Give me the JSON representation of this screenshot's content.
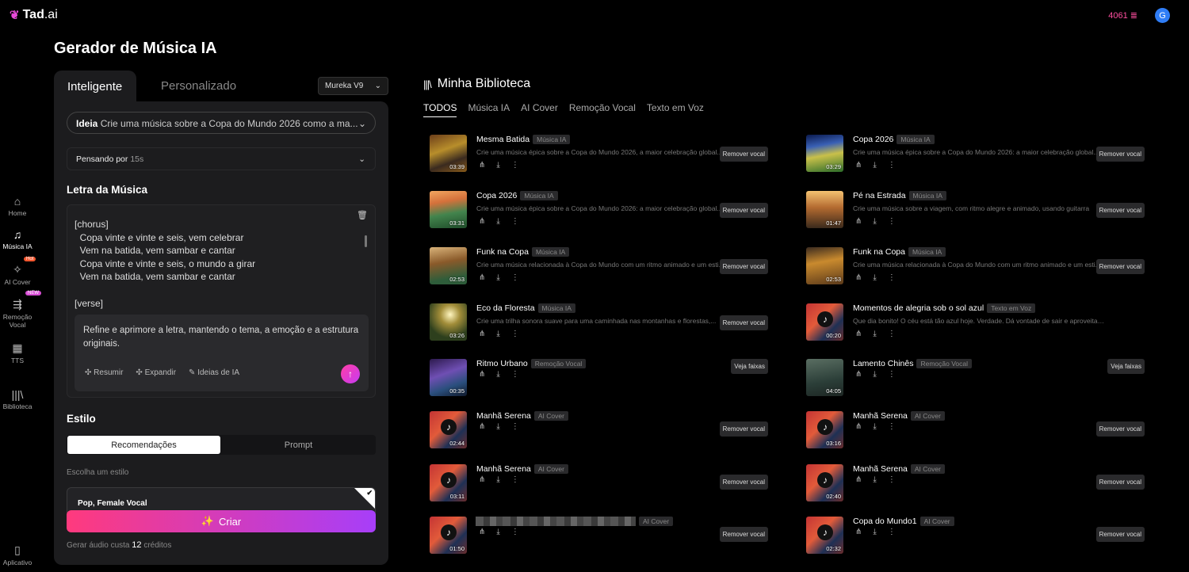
{
  "app": {
    "logo": "Tad",
    "logo_suffix": ".ai",
    "credits": "4061",
    "avatar_initial": "G"
  },
  "sidebar": [
    {
      "label": "Home",
      "icon": "home-icon"
    },
    {
      "label": "Música IA",
      "icon": "music-icon",
      "active": true
    },
    {
      "label": "AI Cover",
      "icon": "cover-icon",
      "badge": "Hot"
    },
    {
      "label": "Remoção Vocal",
      "icon": "vocal-remove-icon",
      "badge": "NEW"
    },
    {
      "label": "TTS",
      "icon": "tts-icon"
    },
    {
      "label": "Biblioteca",
      "icon": "library-icon"
    },
    {
      "label": "Aplicativo",
      "icon": "mobile-icon"
    }
  ],
  "page_title": "Gerador de Música IA",
  "mode_tabs": {
    "active": "Inteligente",
    "inactive": "Personalizado"
  },
  "model": "Mureka V9",
  "idea": {
    "label": "Ideia",
    "text": "Crie uma música sobre a Copa do Mundo 2026 como a ma..."
  },
  "thinking": {
    "label": "Pensando por",
    "time": "15s"
  },
  "lyrics_title": "Letra da Música",
  "lyrics_text": "[chorus]\n  Copa vinte e vinte e seis, vem celebrar\n  Vem na batida, vem sambar e cantar\n  Copa vinte e vinte e seis, o mundo a girar\n  Vem na batida, vem sambar e cantar\n\n[verse]",
  "refine": {
    "text": "Refine e aprimore a letra, mantendo o tema, a emoção e a estrutura originais.",
    "actions": [
      "Resumir",
      "Expandir",
      "Ideias de IA"
    ]
  },
  "style": {
    "title": "Estilo",
    "tabs": [
      "Recomendações",
      "Prompt"
    ],
    "choose_label": "Escolha um estilo",
    "selected": "Pop, Female Vocal"
  },
  "create_label": "Criar",
  "cost": {
    "prefix": "Gerar áudio custa",
    "amount": "12",
    "suffix": "créditos"
  },
  "library": {
    "title": "Minha Biblioteca",
    "filters": [
      "TODOS",
      "Música IA",
      "AI Cover",
      "Remoção Vocal",
      "Texto em Voz"
    ]
  },
  "songs": [
    {
      "name": "Mesma Batida",
      "tag": "Música IA",
      "desc": "Crie uma música épica sobre a Copa do Mundo 2026, a maior celebração global...",
      "dur": "03:39",
      "btn": "Remover vocal",
      "thumb": "t1"
    },
    {
      "name": "Copa 2026",
      "tag": "Música IA",
      "desc": "Crie uma música épica sobre a Copa do Mundo 2026: a maior celebração global...",
      "dur": "03:29",
      "btn": "Remover vocal",
      "thumb": "t2"
    },
    {
      "name": "Copa 2026",
      "tag": "Música IA",
      "desc": "Crie uma música épica sobre a Copa do Mundo 2026: a maior celebração global...",
      "dur": "03:31",
      "btn": "Remover vocal",
      "thumb": "t3"
    },
    {
      "name": "Pé na Estrada",
      "tag": "Música IA",
      "desc": "Crie uma música sobre a viagem, com ritmo alegre e animado, usando guitarra",
      "dur": "01:47",
      "btn": "Remover vocal",
      "thumb": "t4"
    },
    {
      "name": "Funk na Copa",
      "tag": "Música IA",
      "desc": "Crie uma música relacionada à Copa do Mundo com um ritmo animado e um esti...",
      "dur": "02:53",
      "btn": "Remover vocal",
      "thumb": "t5"
    },
    {
      "name": "Funk na Copa",
      "tag": "Música IA",
      "desc": "Crie uma música relacionada à Copa do Mundo com um ritmo animado e um esti...",
      "dur": "02:53",
      "btn": "Remover vocal",
      "thumb": "t6"
    },
    {
      "name": "Eco da Floresta",
      "tag": "Música IA",
      "desc": "Crie uma trilha sonora suave para uma caminhada nas montanhas e florestas,...",
      "dur": "03:26",
      "btn": "Remover vocal",
      "thumb": "t7"
    },
    {
      "name": "Momentos de alegria sob o sol azul",
      "tag": "Texto em Voz",
      "desc": "Que dia bonito! O céu está tão azul hoje. Verdade. Dá vontade de sair e aproveitar o sol. Às veze...",
      "dur": "00:20",
      "btn": "",
      "thumb": "tr",
      "note": true
    },
    {
      "name": "Ritmo Urbano",
      "tag": "Remoção Vocal",
      "desc": "",
      "dur": "00:35",
      "btn": "Veja faixas",
      "thumb": "t8"
    },
    {
      "name": "Lamento Chinês",
      "tag": "Remoção Vocal",
      "desc": "",
      "dur": "04:05",
      "btn": "Veja faixas",
      "thumb": "t9"
    },
    {
      "name": "Manhã Serena",
      "tag": "AI Cover",
      "desc": "",
      "dur": "02:44",
      "btn": "Remover vocal",
      "thumb": "tr",
      "note": true
    },
    {
      "name": "Manhã Serena",
      "tag": "AI Cover",
      "desc": "",
      "dur": "03:16",
      "btn": "Remover vocal",
      "thumb": "tr",
      "note": true
    },
    {
      "name": "Manhã Serena",
      "tag": "AI Cover",
      "desc": "",
      "dur": "03:11",
      "btn": "Remover vocal",
      "thumb": "tr",
      "note": true
    },
    {
      "name": "Manhã Serena",
      "tag": "AI Cover",
      "desc": "",
      "dur": "02:40",
      "btn": "Remover vocal",
      "thumb": "tr",
      "note": true
    },
    {
      "name": "",
      "tag": "AI Cover",
      "desc": "",
      "dur": "01:50",
      "btn": "Remover vocal",
      "thumb": "tr",
      "note": true,
      "blurred": true
    },
    {
      "name": "Copa do Mundo1",
      "tag": "AI Cover",
      "desc": "",
      "dur": "02:32",
      "btn": "Remover vocal",
      "thumb": "tr",
      "note": true
    }
  ]
}
